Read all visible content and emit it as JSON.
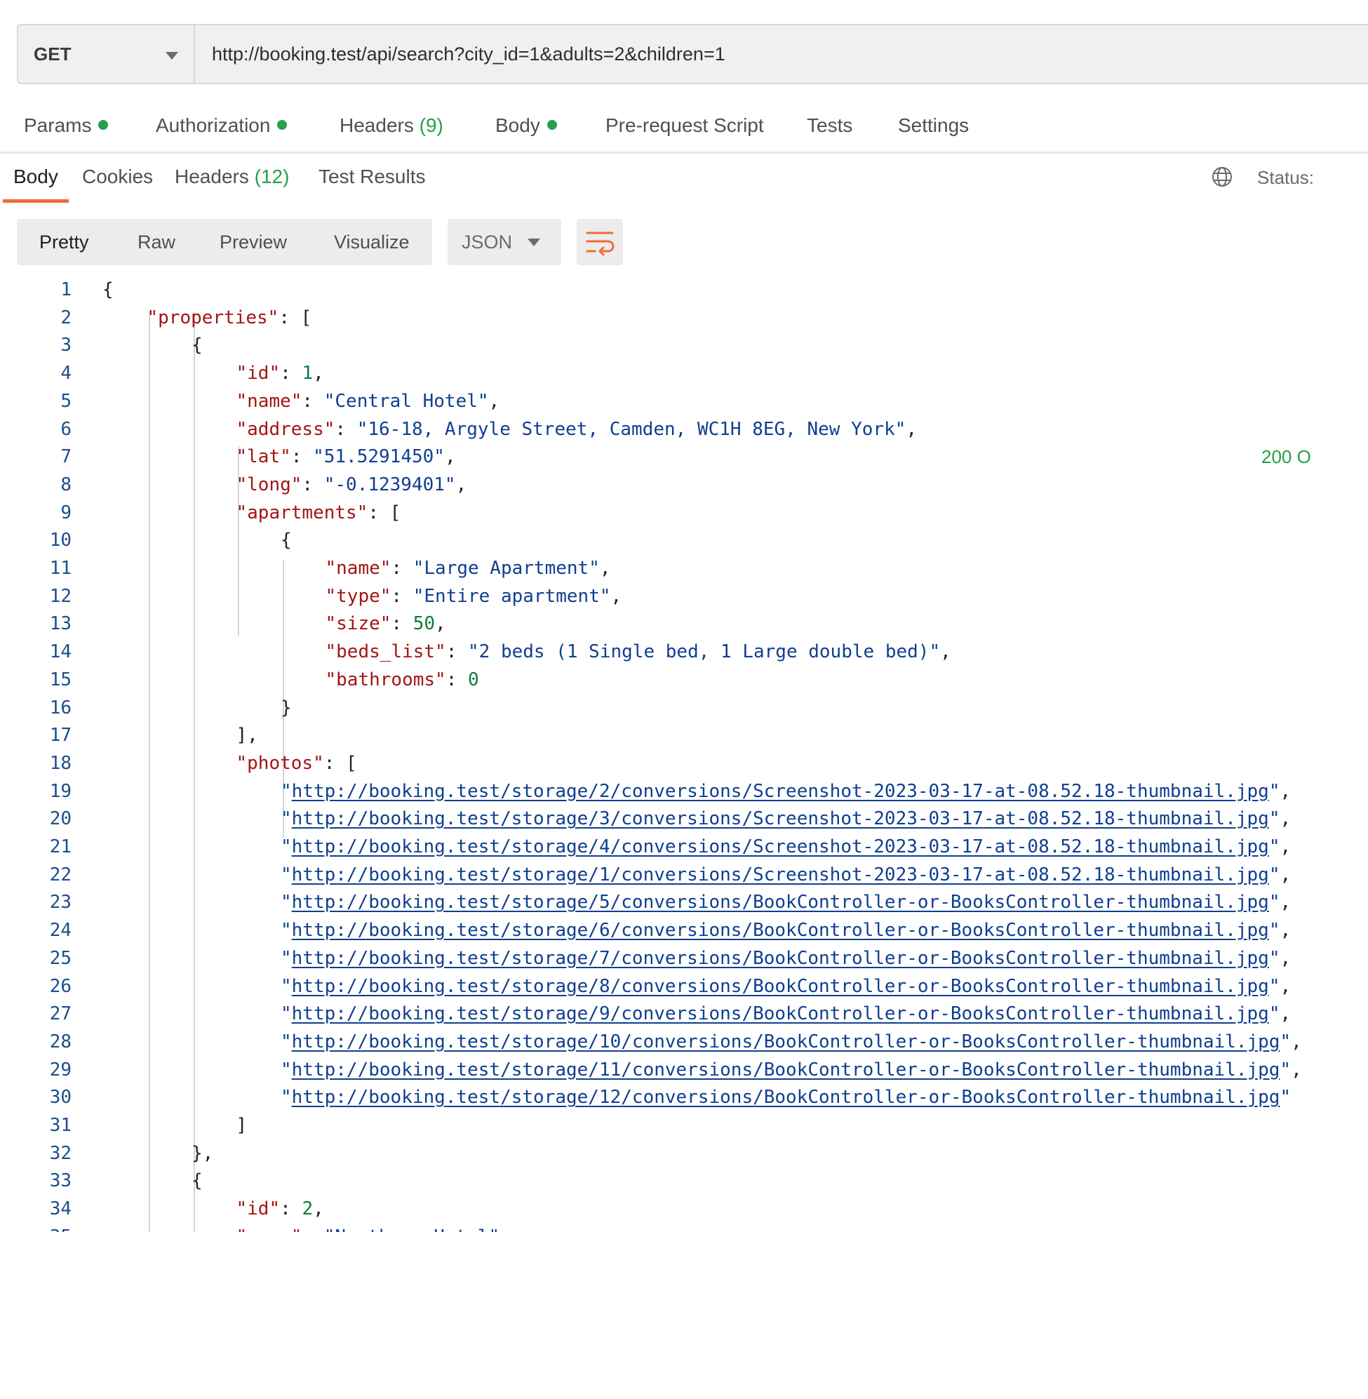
{
  "request": {
    "method": "GET",
    "url": "http://booking.test/api/search?city_id=1&adults=2&children=1"
  },
  "request_tabs": [
    {
      "label": "Params",
      "dot": true
    },
    {
      "label": "Authorization",
      "dot": true
    },
    {
      "label": "Headers",
      "count": "(9)"
    },
    {
      "label": "Body",
      "dot": true
    },
    {
      "label": "Pre-request Script"
    },
    {
      "label": "Tests"
    },
    {
      "label": "Settings"
    }
  ],
  "response_tabs": [
    {
      "label": "Body",
      "active": true
    },
    {
      "label": "Cookies"
    },
    {
      "label": "Headers",
      "count": "(12)"
    },
    {
      "label": "Test Results"
    }
  ],
  "status": {
    "label": "Status:",
    "value": "200 O"
  },
  "view_modes": [
    "Pretty",
    "Raw",
    "Preview",
    "Visualize"
  ],
  "format": "JSON",
  "icons": {
    "method_caret": "chevron-down-icon",
    "format_caret": "chevron-down-icon",
    "wrap": "wrap-lines-icon",
    "globe": "globe-icon"
  },
  "colors": {
    "accent": "#f26b3a",
    "success": "#26a04a",
    "key": "#a31515",
    "string": "#0f3f8f",
    "number": "#0e7a3e"
  },
  "code_lines": [
    {
      "indent": 0,
      "parts": [
        {
          "t": "{",
          "c": "p"
        }
      ]
    },
    {
      "indent": 1,
      "parts": [
        {
          "t": "\"properties\"",
          "c": "k"
        },
        {
          "t": ": [",
          "c": "p"
        }
      ]
    },
    {
      "indent": 2,
      "parts": [
        {
          "t": "{",
          "c": "p"
        }
      ]
    },
    {
      "indent": 3,
      "parts": [
        {
          "t": "\"id\"",
          "c": "k"
        },
        {
          "t": ": ",
          "c": "p"
        },
        {
          "t": "1",
          "c": "n"
        },
        {
          "t": ",",
          "c": "p"
        }
      ]
    },
    {
      "indent": 3,
      "parts": [
        {
          "t": "\"name\"",
          "c": "k"
        },
        {
          "t": ": ",
          "c": "p"
        },
        {
          "t": "\"Central Hotel\"",
          "c": "s"
        },
        {
          "t": ",",
          "c": "p"
        }
      ]
    },
    {
      "indent": 3,
      "parts": [
        {
          "t": "\"address\"",
          "c": "k"
        },
        {
          "t": ": ",
          "c": "p"
        },
        {
          "t": "\"16-18, Argyle Street, Camden, WC1H 8EG, New York\"",
          "c": "s"
        },
        {
          "t": ",",
          "c": "p"
        }
      ]
    },
    {
      "indent": 3,
      "parts": [
        {
          "t": "\"lat\"",
          "c": "k"
        },
        {
          "t": ": ",
          "c": "p"
        },
        {
          "t": "\"51.5291450\"",
          "c": "s"
        },
        {
          "t": ",",
          "c": "p"
        }
      ]
    },
    {
      "indent": 3,
      "parts": [
        {
          "t": "\"long\"",
          "c": "k"
        },
        {
          "t": ": ",
          "c": "p"
        },
        {
          "t": "\"-0.1239401\"",
          "c": "s"
        },
        {
          "t": ",",
          "c": "p"
        }
      ]
    },
    {
      "indent": 3,
      "parts": [
        {
          "t": "\"apartments\"",
          "c": "k"
        },
        {
          "t": ": [",
          "c": "p"
        }
      ]
    },
    {
      "indent": 4,
      "parts": [
        {
          "t": "{",
          "c": "p"
        }
      ]
    },
    {
      "indent": 5,
      "parts": [
        {
          "t": "\"name\"",
          "c": "k"
        },
        {
          "t": ": ",
          "c": "p"
        },
        {
          "t": "\"Large Apartment\"",
          "c": "s"
        },
        {
          "t": ",",
          "c": "p"
        }
      ]
    },
    {
      "indent": 5,
      "parts": [
        {
          "t": "\"type\"",
          "c": "k"
        },
        {
          "t": ": ",
          "c": "p"
        },
        {
          "t": "\"Entire apartment\"",
          "c": "s"
        },
        {
          "t": ",",
          "c": "p"
        }
      ]
    },
    {
      "indent": 5,
      "parts": [
        {
          "t": "\"size\"",
          "c": "k"
        },
        {
          "t": ": ",
          "c": "p"
        },
        {
          "t": "50",
          "c": "n"
        },
        {
          "t": ",",
          "c": "p"
        }
      ]
    },
    {
      "indent": 5,
      "parts": [
        {
          "t": "\"beds_list\"",
          "c": "k"
        },
        {
          "t": ": ",
          "c": "p"
        },
        {
          "t": "\"2 beds (1 Single bed, 1 Large double bed)\"",
          "c": "s"
        },
        {
          "t": ",",
          "c": "p"
        }
      ]
    },
    {
      "indent": 5,
      "parts": [
        {
          "t": "\"bathrooms\"",
          "c": "k"
        },
        {
          "t": ": ",
          "c": "p"
        },
        {
          "t": "0",
          "c": "n"
        }
      ]
    },
    {
      "indent": 4,
      "parts": [
        {
          "t": "}",
          "c": "p"
        }
      ]
    },
    {
      "indent": 3,
      "parts": [
        {
          "t": "],",
          "c": "p"
        }
      ]
    },
    {
      "indent": 3,
      "parts": [
        {
          "t": "\"photos\"",
          "c": "k"
        },
        {
          "t": ": [",
          "c": "p"
        }
      ]
    },
    {
      "indent": 4,
      "parts": [
        {
          "t": "\"",
          "c": "s"
        },
        {
          "t": "http://booking.test/storage/2/conversions/Screenshot-2023-03-17-at-08.52.18-thumbnail.jpg",
          "c": "l"
        },
        {
          "t": "\"",
          "c": "s"
        },
        {
          "t": ",",
          "c": "p"
        }
      ]
    },
    {
      "indent": 4,
      "parts": [
        {
          "t": "\"",
          "c": "s"
        },
        {
          "t": "http://booking.test/storage/3/conversions/Screenshot-2023-03-17-at-08.52.18-thumbnail.jpg",
          "c": "l"
        },
        {
          "t": "\"",
          "c": "s"
        },
        {
          "t": ",",
          "c": "p"
        }
      ]
    },
    {
      "indent": 4,
      "parts": [
        {
          "t": "\"",
          "c": "s"
        },
        {
          "t": "http://booking.test/storage/4/conversions/Screenshot-2023-03-17-at-08.52.18-thumbnail.jpg",
          "c": "l"
        },
        {
          "t": "\"",
          "c": "s"
        },
        {
          "t": ",",
          "c": "p"
        }
      ]
    },
    {
      "indent": 4,
      "parts": [
        {
          "t": "\"",
          "c": "s"
        },
        {
          "t": "http://booking.test/storage/1/conversions/Screenshot-2023-03-17-at-08.52.18-thumbnail.jpg",
          "c": "l"
        },
        {
          "t": "\"",
          "c": "s"
        },
        {
          "t": ",",
          "c": "p"
        }
      ]
    },
    {
      "indent": 4,
      "parts": [
        {
          "t": "\"",
          "c": "s"
        },
        {
          "t": "http://booking.test/storage/5/conversions/BookController-or-BooksController-thumbnail.jpg",
          "c": "l"
        },
        {
          "t": "\"",
          "c": "s"
        },
        {
          "t": ",",
          "c": "p"
        }
      ]
    },
    {
      "indent": 4,
      "parts": [
        {
          "t": "\"",
          "c": "s"
        },
        {
          "t": "http://booking.test/storage/6/conversions/BookController-or-BooksController-thumbnail.jpg",
          "c": "l"
        },
        {
          "t": "\"",
          "c": "s"
        },
        {
          "t": ",",
          "c": "p"
        }
      ]
    },
    {
      "indent": 4,
      "parts": [
        {
          "t": "\"",
          "c": "s"
        },
        {
          "t": "http://booking.test/storage/7/conversions/BookController-or-BooksController-thumbnail.jpg",
          "c": "l"
        },
        {
          "t": "\"",
          "c": "s"
        },
        {
          "t": ",",
          "c": "p"
        }
      ]
    },
    {
      "indent": 4,
      "parts": [
        {
          "t": "\"",
          "c": "s"
        },
        {
          "t": "http://booking.test/storage/8/conversions/BookController-or-BooksController-thumbnail.jpg",
          "c": "l"
        },
        {
          "t": "\"",
          "c": "s"
        },
        {
          "t": ",",
          "c": "p"
        }
      ]
    },
    {
      "indent": 4,
      "parts": [
        {
          "t": "\"",
          "c": "s"
        },
        {
          "t": "http://booking.test/storage/9/conversions/BookController-or-BooksController-thumbnail.jpg",
          "c": "l"
        },
        {
          "t": "\"",
          "c": "s"
        },
        {
          "t": ",",
          "c": "p"
        }
      ]
    },
    {
      "indent": 4,
      "parts": [
        {
          "t": "\"",
          "c": "s"
        },
        {
          "t": "http://booking.test/storage/10/conversions/BookController-or-BooksController-thumbnail.jpg",
          "c": "l"
        },
        {
          "t": "\"",
          "c": "s"
        },
        {
          "t": ",",
          "c": "p"
        }
      ]
    },
    {
      "indent": 4,
      "parts": [
        {
          "t": "\"",
          "c": "s"
        },
        {
          "t": "http://booking.test/storage/11/conversions/BookController-or-BooksController-thumbnail.jpg",
          "c": "l"
        },
        {
          "t": "\"",
          "c": "s"
        },
        {
          "t": ",",
          "c": "p"
        }
      ]
    },
    {
      "indent": 4,
      "parts": [
        {
          "t": "\"",
          "c": "s"
        },
        {
          "t": "http://booking.test/storage/12/conversions/BookController-or-BooksController-thumbnail.jpg",
          "c": "l"
        },
        {
          "t": "\"",
          "c": "s"
        }
      ]
    },
    {
      "indent": 3,
      "parts": [
        {
          "t": "]",
          "c": "p"
        }
      ]
    },
    {
      "indent": 2,
      "parts": [
        {
          "t": "},",
          "c": "p"
        }
      ]
    },
    {
      "indent": 2,
      "parts": [
        {
          "t": "{",
          "c": "p"
        }
      ]
    },
    {
      "indent": 3,
      "parts": [
        {
          "t": "\"id\"",
          "c": "k"
        },
        {
          "t": ": ",
          "c": "p"
        },
        {
          "t": "2",
          "c": "n"
        },
        {
          "t": ",",
          "c": "p"
        }
      ]
    },
    {
      "indent": 3,
      "parts": [
        {
          "t": "\"name\"",
          "c": "k"
        },
        {
          "t": ": ",
          "c": "p"
        },
        {
          "t": "\"Northern Hotel\"",
          "c": "s"
        },
        {
          "t": ",",
          "c": "p"
        }
      ]
    }
  ]
}
